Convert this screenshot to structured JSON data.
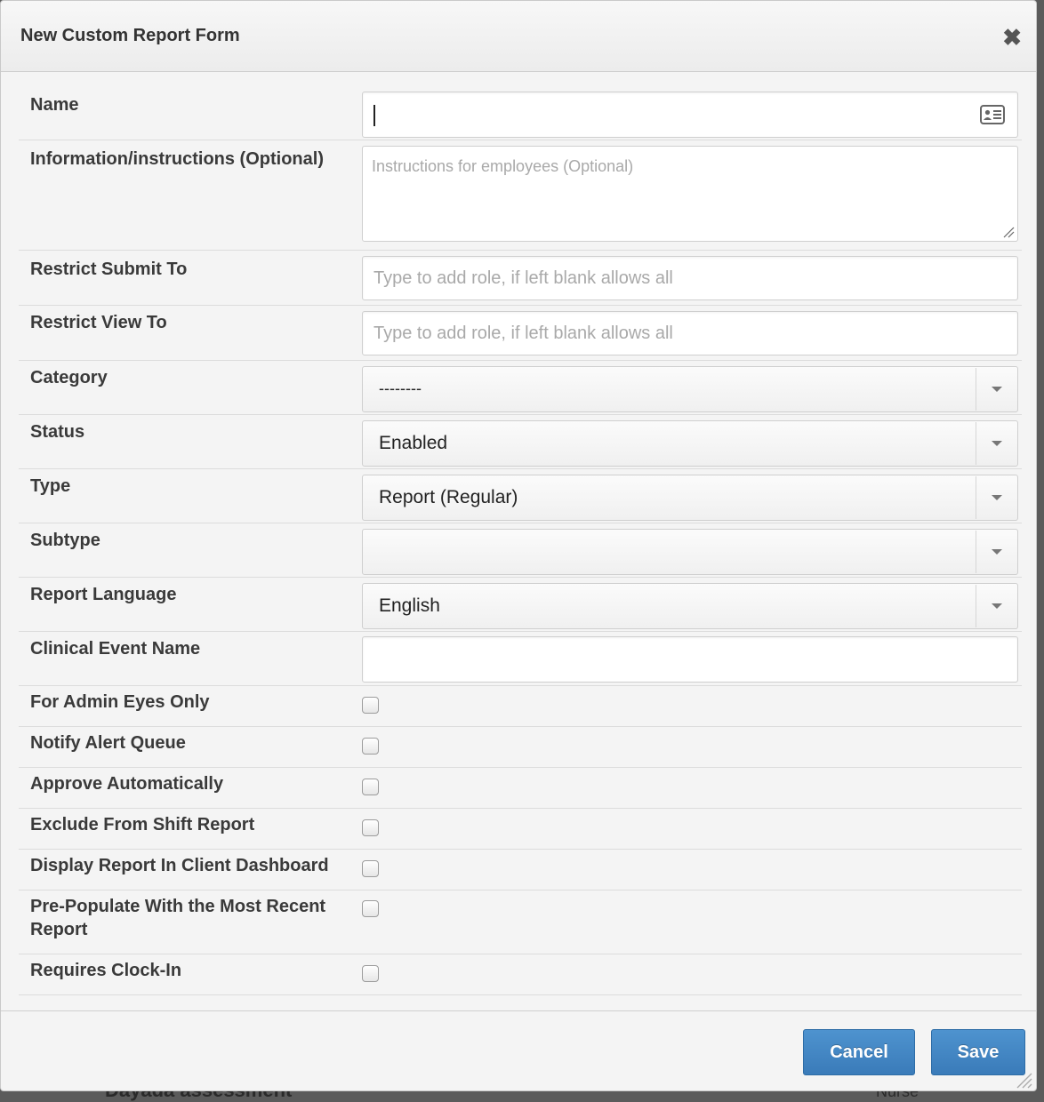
{
  "backdrop": {
    "partial_text": "Dayada assessment",
    "partial_right": "Nurse"
  },
  "modal": {
    "title": "New Custom Report Form",
    "close_glyph": "✖"
  },
  "fields": {
    "name": {
      "label": "Name",
      "value": "",
      "icon": "contact-card-icon"
    },
    "info": {
      "label": "Information/instructions (Optional)",
      "placeholder": "Instructions for employees (Optional)"
    },
    "restrict_submit": {
      "label": "Restrict Submit To",
      "placeholder": "Type to add role, if left blank allows all"
    },
    "restrict_view": {
      "label": "Restrict View To",
      "placeholder": "Type to add role, if left blank allows all"
    },
    "category": {
      "label": "Category",
      "selected": "--------"
    },
    "status": {
      "label": "Status",
      "selected": "Enabled"
    },
    "type": {
      "label": "Type",
      "selected": "Report (Regular)"
    },
    "subtype": {
      "label": "Subtype",
      "selected": ""
    },
    "language": {
      "label": "Report Language",
      "selected": "English"
    },
    "clinical_event": {
      "label": "Clinical Event Name",
      "value": ""
    }
  },
  "checkboxes": [
    {
      "label": "For Admin Eyes Only",
      "checked": false
    },
    {
      "label": "Notify Alert Queue",
      "checked": false
    },
    {
      "label": "Approve Automatically",
      "checked": false
    },
    {
      "label": "Exclude From Shift Report",
      "checked": false
    },
    {
      "label": "Display Report In Client Dashboard",
      "checked": false
    },
    {
      "label": "Pre-Populate With the Most Recent",
      "label_line2": "Report",
      "checked": false
    },
    {
      "label": "Requires Clock-In",
      "checked": false
    }
  ],
  "footer": {
    "cancel_label": "Cancel",
    "save_label": "Save"
  },
  "colors": {
    "primary_button": "#3a7bb9",
    "modal_background": "#f4f4f4"
  }
}
